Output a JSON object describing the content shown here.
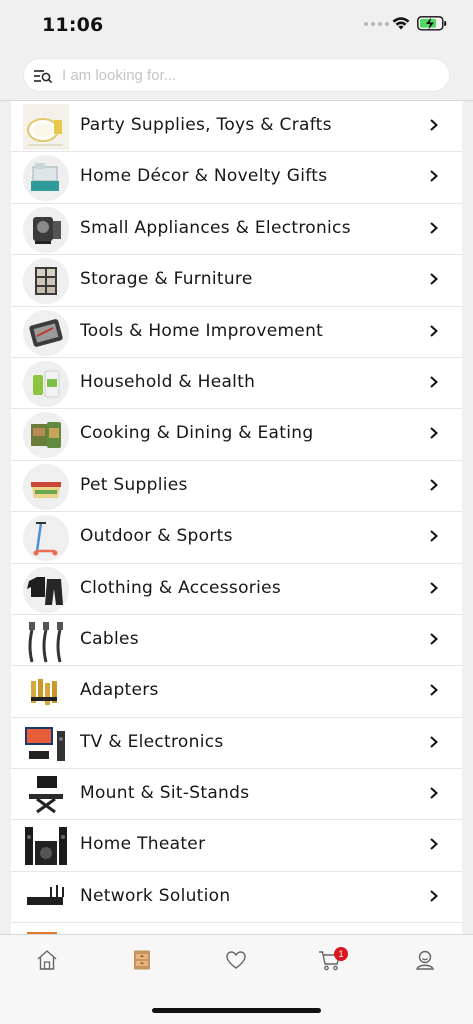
{
  "status": {
    "time": "11:06"
  },
  "search": {
    "placeholder": "I am looking for..."
  },
  "categories": [
    {
      "label": "Party Supplies, Toys & Crafts",
      "icon": "party-supplies-icon"
    },
    {
      "label": "Home Décor & Novelty Gifts",
      "icon": "home-decor-icon"
    },
    {
      "label": "Small Appliances & Electronics",
      "icon": "small-appliances-icon"
    },
    {
      "label": "Storage & Furniture",
      "icon": "storage-furniture-icon"
    },
    {
      "label": "Tools & Home Improvement",
      "icon": "tools-icon"
    },
    {
      "label": "Household & Health",
      "icon": "household-health-icon"
    },
    {
      "label": "Cooking & Dining & Eating",
      "icon": "cooking-dining-icon"
    },
    {
      "label": "Pet Supplies",
      "icon": "pet-supplies-icon"
    },
    {
      "label": "Outdoor & Sports",
      "icon": "outdoor-sports-icon"
    },
    {
      "label": "Clothing & Accessories",
      "icon": "clothing-icon"
    },
    {
      "label": "Cables",
      "icon": "cables-icon"
    },
    {
      "label": "Adapters",
      "icon": "adapters-icon"
    },
    {
      "label": "TV & Electronics",
      "icon": "tv-electronics-icon"
    },
    {
      "label": "Mount & Sit-Stands",
      "icon": "mount-stand-icon"
    },
    {
      "label": "Home Theater",
      "icon": "home-theater-icon"
    },
    {
      "label": "Network Solution",
      "icon": "network-router-icon"
    }
  ],
  "tabbar": {
    "cart_badge": "1",
    "active_tab": "categories",
    "accent_color": "#c8935a"
  },
  "colors": {
    "badge": "#d7181f",
    "background": "#f0f0f0"
  }
}
